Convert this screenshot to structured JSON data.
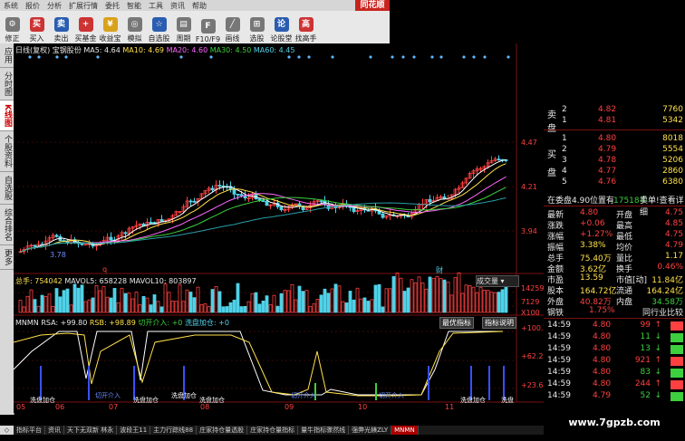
{
  "menu": [
    "系统",
    "报价",
    "分析",
    "扩展行情",
    "委托",
    "智能",
    "工具",
    "资讯",
    "帮助"
  ],
  "brand": "同花顺",
  "toolbar": [
    {
      "label": "修正",
      "icon": "gear-icon",
      "color": "gray"
    },
    {
      "label": "买入",
      "icon": "buy-icon",
      "glyph": "买",
      "color": "red"
    },
    {
      "label": "卖出",
      "icon": "sell-icon",
      "glyph": "卖",
      "color": "blue"
    },
    {
      "label": "买基金",
      "icon": "fund-icon",
      "glyph": "+",
      "color": "red"
    },
    {
      "label": "收益宝",
      "icon": "treasure-icon",
      "glyph": "¥",
      "color": "yellow"
    },
    {
      "label": "模拟",
      "icon": "sim-icon",
      "glyph": "◎",
      "color": "gray"
    },
    {
      "label": "自选股",
      "icon": "star-icon",
      "glyph": "☆",
      "color": "blue"
    },
    {
      "label": "周期",
      "icon": "cycle-icon",
      "glyph": "▤",
      "color": "gray"
    },
    {
      "label": "F10/F9",
      "icon": "f10-icon",
      "glyph": "F",
      "color": "gray"
    },
    {
      "label": "画线",
      "icon": "drawline-icon",
      "glyph": "╱",
      "color": "gray"
    },
    {
      "label": "选股",
      "icon": "select-icon",
      "glyph": "⊞",
      "color": "gray"
    },
    {
      "label": "论股堂",
      "icon": "forum-icon",
      "glyph": "论",
      "color": "blue"
    },
    {
      "label": "找高手",
      "icon": "expert-icon",
      "glyph": "高",
      "color": "red"
    }
  ],
  "sidebar": [
    "应用",
    "分时图",
    "K线图",
    "个股资料",
    "自选股",
    "综合排名",
    "更多"
  ],
  "chart": {
    "title": "日线(复权)",
    "stock": "宝钢股份",
    "ma5": "MA5: 4.64",
    "ma10": "MA10: 4.69",
    "ma20": "MA20: 4.60",
    "ma30": "MA30: 4.50",
    "ma60": "MA60: 4.45",
    "price_labels": [
      "4.47",
      "4.21",
      "3.94"
    ],
    "marker_q": "q",
    "marker_cai": "财",
    "marker_lowlabel": "3.78"
  },
  "volume": {
    "text": "总手: 754042",
    "mavol5": "MAVOL5: 658228",
    "mavol10": "MAVOL10: 803897",
    "dropdown": "成交量",
    "scale_top": "14259",
    "scale_mid": "7129",
    "unit": "X100"
  },
  "indicator": {
    "name": "MNMN",
    "rsa": "RSA: +99.80",
    "rsb": "RSB: +98.89",
    "cut_in": "切开介入: +0",
    "wash": "洗盘加仓: +0",
    "best_indicator": "最优指标",
    "indicator_help": "指标说明",
    "scale": [
      "+100.0",
      "+62.20",
      "+23.60"
    ],
    "labels": [
      "洗盘加仓",
      "切开介入",
      "洗盘加仓",
      "洗盘加仓",
      "洗盘加仓",
      "切开介入",
      "切开介入",
      "洗盘加仓",
      "洗盘"
    ]
  },
  "dates": [
    "05",
    "06",
    "07",
    "08",
    "09",
    "10",
    "11"
  ],
  "tabs": [
    "指标平台",
    "资讯",
    "天下无双新 林永",
    "波段王11",
    "主力行踪线88",
    "庄家持仓量透股",
    "庄家持仓量指标",
    "量牛指标骤然线",
    "强弊光錶ZLY",
    "MNMN"
  ],
  "quote": {
    "sell_label": "卖盘",
    "sell": [
      {
        "n": "2",
        "p": "4.82",
        "v": "7760"
      },
      {
        "n": "1",
        "p": "4.81",
        "v": "5342"
      }
    ],
    "buy_label": "买盘",
    "buy": [
      {
        "n": "1",
        "p": "4.80",
        "v": "8018"
      },
      {
        "n": "2",
        "p": "4.79",
        "v": "5554"
      },
      {
        "n": "3",
        "p": "4.78",
        "v": "5206"
      },
      {
        "n": "4",
        "p": "4.77",
        "v": "2860"
      },
      {
        "n": "5",
        "p": "4.76",
        "v": "6380"
      }
    ],
    "weibi_line": "在委盘4.90位置有",
    "weibi_vol": "17518手",
    "weibi_tail": "卖单!查看详细",
    "fields": [
      [
        "最新",
        "4.80",
        "开盘",
        "4.75"
      ],
      [
        "涨跌",
        "+0.06",
        "最高",
        "4.85"
      ],
      [
        "涨幅",
        "+1.27%",
        "最低",
        "4.75"
      ],
      [
        "振幅",
        "3.38%",
        "均价",
        "4.79"
      ],
      [
        "总手",
        "75.40万",
        "量比",
        "1.17"
      ],
      [
        "金额",
        "3.62亿",
        "换手",
        "0.46%"
      ],
      [
        "市盈",
        "13.59",
        "市值[动]",
        "11.84亿"
      ],
      [
        "股本",
        "164.72亿",
        "流通",
        "164.24亿"
      ],
      [
        "外盘",
        "40.82万",
        "内盘",
        "34.58万"
      ]
    ],
    "industry": "钢铁",
    "industry_pct": "1.75%",
    "peer_compare": "同行业比较",
    "ticks": [
      {
        "t": "14:59",
        "p": "4.80",
        "v": "99",
        "d": "up"
      },
      {
        "t": "14:59",
        "p": "4.80",
        "v": "11",
        "d": "down"
      },
      {
        "t": "14:59",
        "p": "4.80",
        "v": "13",
        "d": "down"
      },
      {
        "t": "14:59",
        "p": "4.80",
        "v": "921",
        "d": "up"
      },
      {
        "t": "14:59",
        "p": "4.80",
        "v": "83",
        "d": "down"
      },
      {
        "t": "14:59",
        "p": "4.80",
        "v": "244",
        "d": "up"
      },
      {
        "t": "14:59",
        "p": "4.79",
        "v": "52",
        "d": "down"
      }
    ],
    "watermark": "www.7gpzb.com"
  },
  "colors": {
    "up": "#ff4040",
    "down": "#3ecf3e",
    "bg": "#000000",
    "grid": "#7a1010"
  }
}
